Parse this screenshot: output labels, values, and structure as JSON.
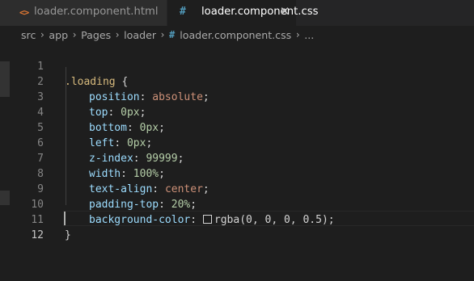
{
  "tabs": [
    {
      "icon": "<>",
      "label": "loader.component.html",
      "active": false
    },
    {
      "icon": "#",
      "label": "loader.component.css",
      "active": true,
      "close": "✕"
    }
  ],
  "breadcrumb": {
    "items": [
      "src",
      "app",
      "Pages",
      "loader"
    ],
    "file_icon": "#",
    "file": "loader.component.css",
    "ellipsis": "..."
  },
  "code": {
    "line_numbers": [
      "1",
      "2",
      "3",
      "4",
      "5",
      "6",
      "7",
      "8",
      "9",
      "10",
      "11",
      "12"
    ],
    "selector": ".loading",
    "open_brace": "{",
    "close_brace": "}",
    "declarations": [
      {
        "prop": "position",
        "value": "absolute",
        "kind": "val"
      },
      {
        "prop": "top",
        "value": "0px",
        "kind": "num"
      },
      {
        "prop": "bottom",
        "value": "0px",
        "kind": "num"
      },
      {
        "prop": "left",
        "value": "0px",
        "kind": "num"
      },
      {
        "prop": "z-index",
        "value": "99999",
        "kind": "num"
      },
      {
        "prop": "width",
        "value": "100%",
        "kind": "num"
      },
      {
        "prop": "text-align",
        "value": "center",
        "kind": "val"
      },
      {
        "prop": "padding-top",
        "value": "20%",
        "kind": "num"
      },
      {
        "prop": "background-color",
        "value": "rgba(0, 0, 0, 0.5)",
        "kind": "color"
      }
    ],
    "active_line": "12"
  },
  "colors": {
    "background": "#1e1e1e",
    "selector": "#d7ba7d",
    "property": "#9cdcfe",
    "string_value": "#ce9178",
    "number_value": "#b5cea8",
    "css_icon": "#519aba",
    "html_icon": "#e37933"
  }
}
